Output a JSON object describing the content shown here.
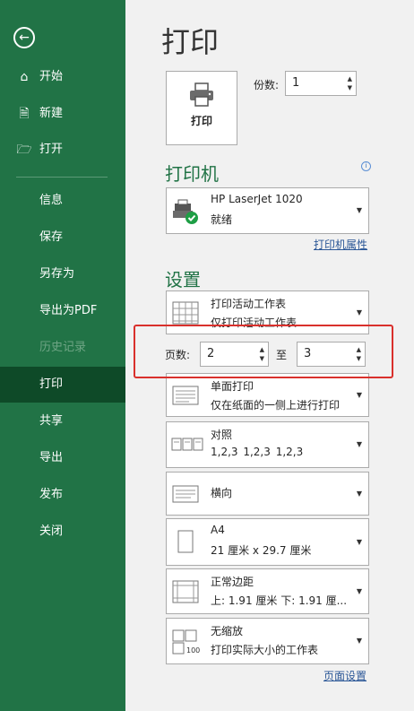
{
  "sidebar": {
    "items": [
      {
        "label": "开始",
        "icon": "home-icon"
      },
      {
        "label": "新建",
        "icon": "new-document-icon"
      },
      {
        "label": "打开",
        "icon": "open-folder-icon"
      },
      {
        "label": "信息"
      },
      {
        "label": "保存"
      },
      {
        "label": "另存为"
      },
      {
        "label": "导出为PDF"
      },
      {
        "label": "历史记录"
      },
      {
        "label": "打印"
      },
      {
        "label": "共享"
      },
      {
        "label": "导出"
      },
      {
        "label": "发布"
      },
      {
        "label": "关闭"
      }
    ],
    "active_label": "打印",
    "accent": "#217346",
    "active_bg": "#0e4a28"
  },
  "main": {
    "title": "打印",
    "print_button": "打印",
    "copies_label": "份数:",
    "copies_value": "1",
    "printer_section": "打印机",
    "printer_name": "HP LaserJet 1020",
    "printer_status": "就绪",
    "printer_props_link": "打印机属性",
    "settings_section": "设置",
    "print_what": {
      "line1": "打印活动工作表",
      "line2": "仅打印活动工作表"
    },
    "pages_label": "页数:",
    "pages_from": "2",
    "to_label": "至",
    "pages_to": "3",
    "sides": {
      "line1": "单面打印",
      "line2": "仅在纸面的一侧上进行打印"
    },
    "collate": {
      "line1": "对照",
      "line2": "1,2,3    1,2,3    1,2,3"
    },
    "orientation": {
      "line1": "横向"
    },
    "paper": {
      "line1": "A4",
      "line2": "21 厘米 x 29.7 厘米"
    },
    "margins": {
      "line1": "正常边距",
      "line2": "上: 1.91 厘米 下: 1.91 厘..."
    },
    "scaling": {
      "line1": "无缩放",
      "line2": "打印实际大小的工作表"
    },
    "page_setup_link": "页面设置",
    "scaling_icon_text": "100"
  }
}
